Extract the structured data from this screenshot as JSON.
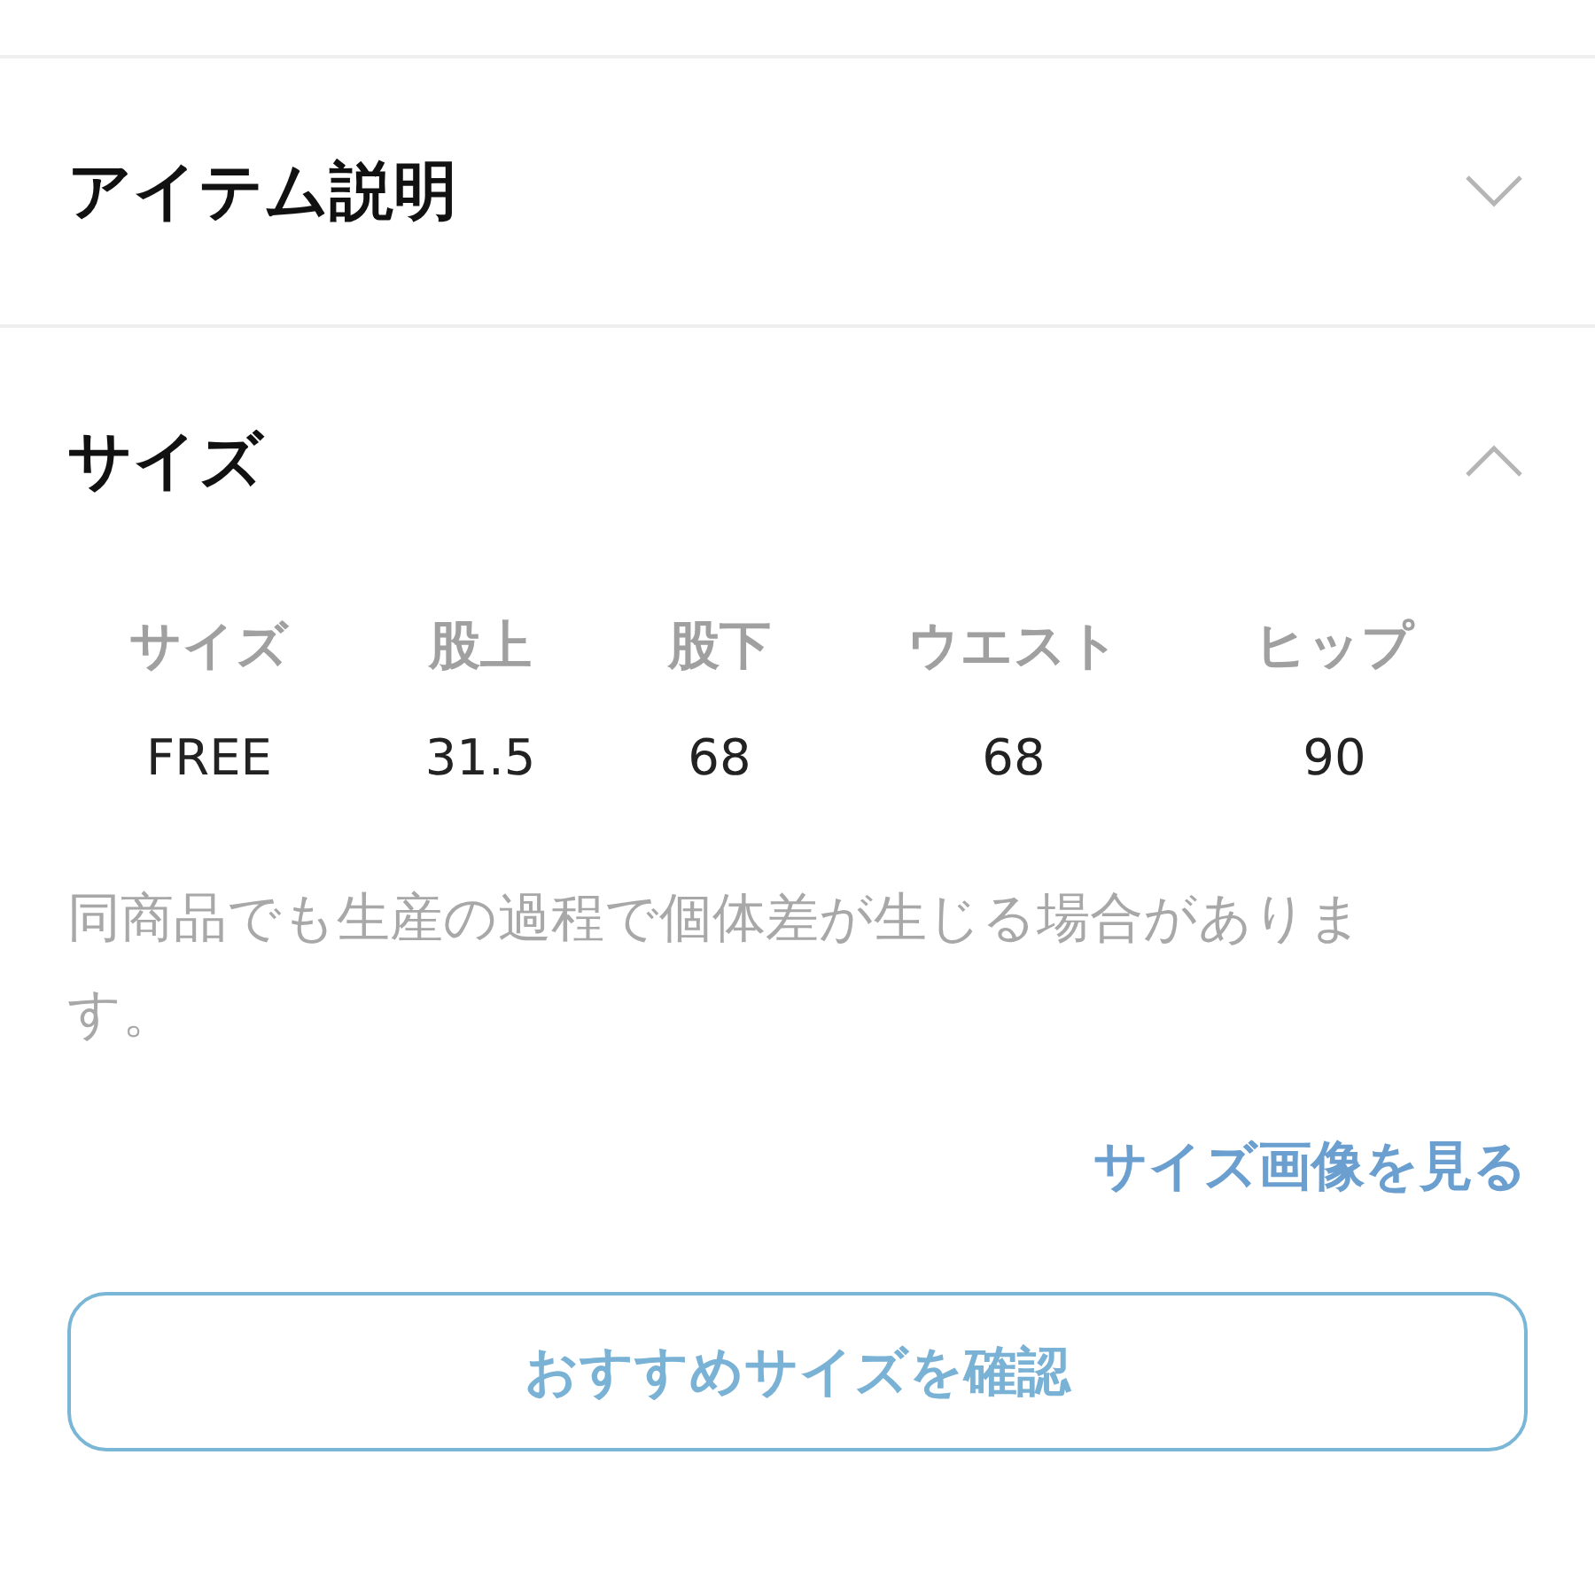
{
  "sections": [
    {
      "title": "アイテム説明",
      "expanded": false
    },
    {
      "title": "サイズ",
      "expanded": true,
      "size_table": {
        "columns": [
          "サイズ",
          "股上",
          "股下",
          "ウエスト",
          "ヒップ"
        ],
        "rows": [
          [
            "FREE",
            "31.5",
            "68",
            "68",
            "90"
          ]
        ]
      },
      "note": "同商品でも生産の過程で個体差が生じる場合があります。",
      "link": "サイズ画像を見る",
      "button": "おすすめサイズを確認"
    }
  ]
}
